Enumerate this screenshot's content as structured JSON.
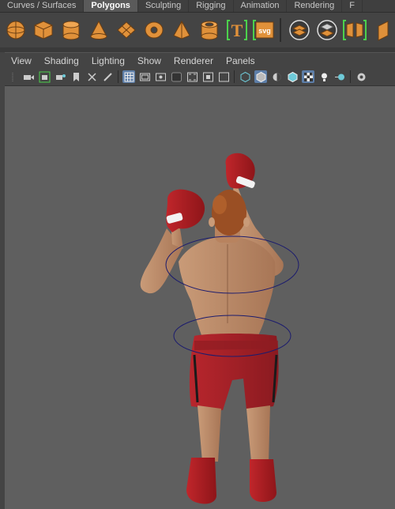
{
  "shelf_tabs": [
    "Curves / Surfaces",
    "Polygons",
    "Sculpting",
    "Rigging",
    "Animation",
    "Rendering",
    "F"
  ],
  "active_tab": "Polygons",
  "shelf_icons": [
    "poly-sphere-icon",
    "poly-cube-icon",
    "poly-cylinder-icon",
    "poly-cone-icon",
    "poly-plane-icon",
    "poly-torus-icon",
    "poly-pyramid-icon",
    "poly-pipe-icon",
    "poly-type-icon",
    "svg-icon",
    "combine-icon",
    "separate-icon",
    "mirror-icon"
  ],
  "svg_label": "svg",
  "type_label": "T",
  "panel_menu": [
    "View",
    "Shading",
    "Lighting",
    "Show",
    "Renderer",
    "Panels"
  ],
  "colors": {
    "accent": "#e0913a",
    "selection": "#5d7ea8",
    "viewport": "#5f5f5f",
    "bracket": "#4cd14c"
  }
}
